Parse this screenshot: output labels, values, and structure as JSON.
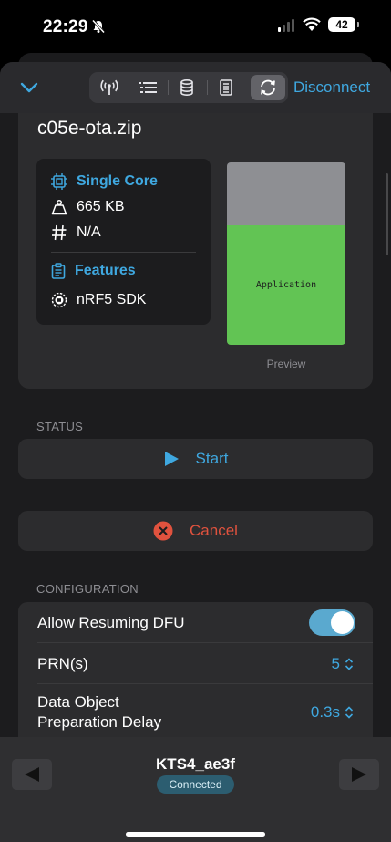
{
  "status_bar": {
    "time": "22:29",
    "battery": "42"
  },
  "toolbar": {
    "tabs": [
      {
        "icon": "antenna-icon",
        "active": false
      },
      {
        "icon": "list-icon",
        "active": false
      },
      {
        "icon": "database-icon",
        "active": false
      },
      {
        "icon": "document-icon",
        "active": false
      },
      {
        "icon": "sync-icon",
        "active": true
      }
    ],
    "disconnect_label": "Disconnect"
  },
  "file": {
    "name": "c05e-ota.zip",
    "core_label": "Single Core",
    "size": "665 KB",
    "hash": "N/A",
    "features_label": "Features",
    "sdk": "nRF5 SDK",
    "preview_segment": "Application",
    "preview_caption": "Preview"
  },
  "status": {
    "section_label": "STATUS",
    "start_label": "Start",
    "cancel_label": "Cancel"
  },
  "configuration": {
    "section_label": "CONFIGURATION",
    "allow_resuming_label": "Allow Resuming DFU",
    "allow_resuming_on": true,
    "prn_label": "PRN(s)",
    "prn_value": "5",
    "delay_label_line1": "Data Object",
    "delay_label_line2": "Preparation Delay",
    "delay_value": "0.3s"
  },
  "device": {
    "name": "KTS4_ae3f",
    "status": "Connected"
  },
  "colors": {
    "accent": "#3fa8e0",
    "danger": "#e0523e",
    "preview_app": "#62c454"
  }
}
